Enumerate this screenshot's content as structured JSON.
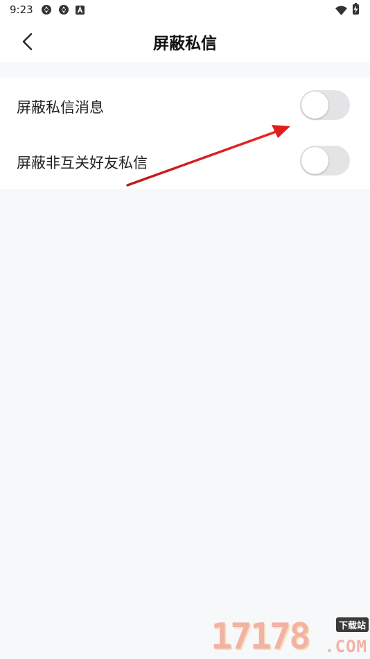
{
  "status_bar": {
    "time": "9:23",
    "icons": [
      "app-notification-icon",
      "app-notification-icon",
      "a-badge-icon",
      "wifi-icon",
      "battery-charging-icon"
    ]
  },
  "header": {
    "title": "屏蔽私信",
    "back_icon": "chevron-left-icon"
  },
  "settings": {
    "items": [
      {
        "label": "屏蔽私信消息",
        "enabled": false
      },
      {
        "label": "屏蔽非互关好友私信",
        "enabled": false
      }
    ]
  },
  "watermark": {
    "digits": "17178",
    "tag": "下载站",
    "domain": ".COM"
  },
  "colors": {
    "background": "#f7f8fa",
    "toggle_off": "#e4e4e7",
    "arrow": "#e11d1d"
  }
}
